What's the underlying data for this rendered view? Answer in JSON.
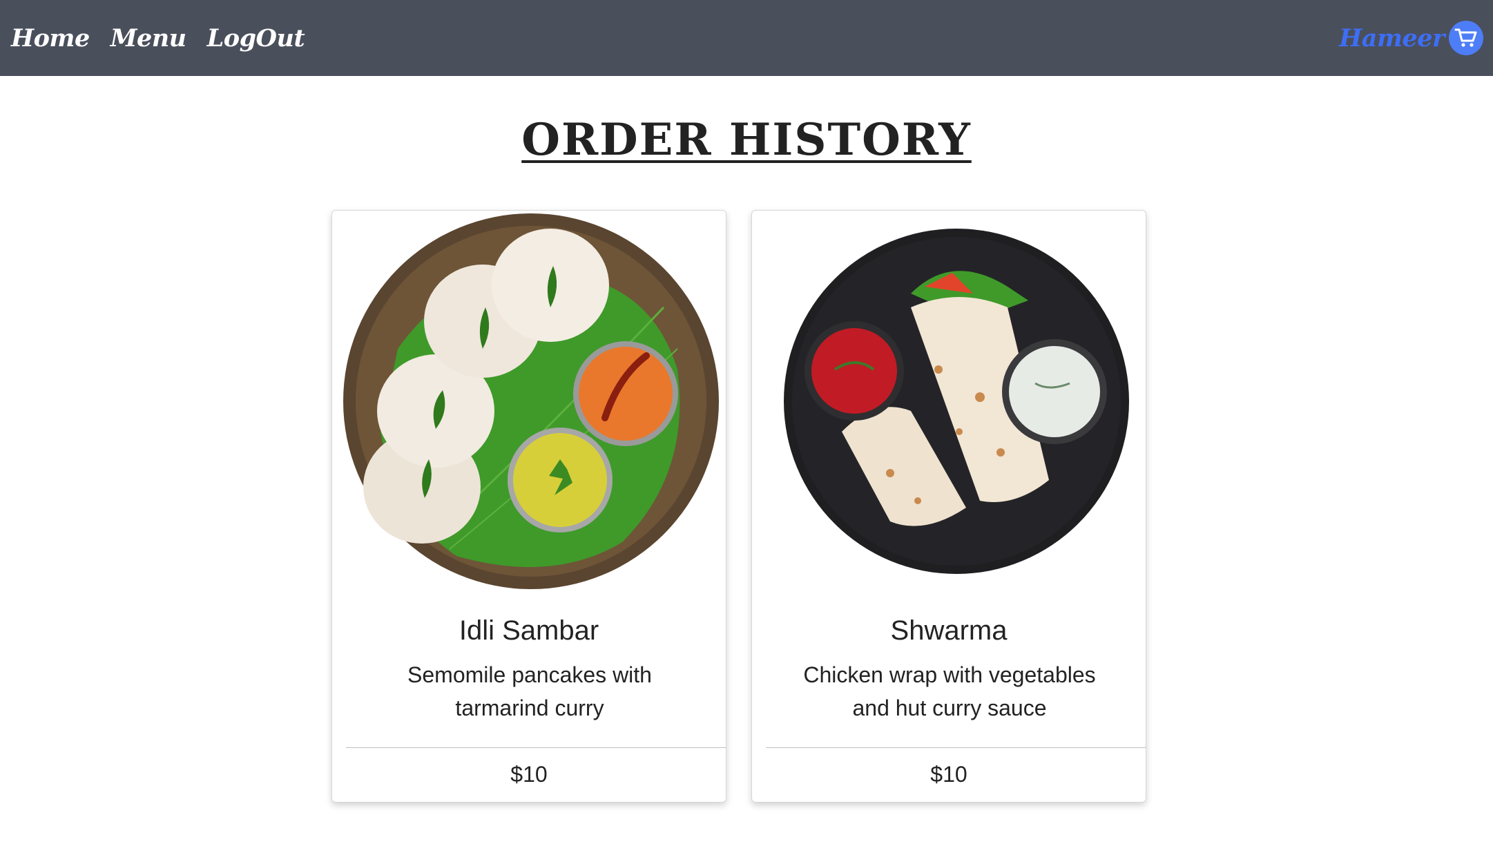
{
  "nav": {
    "home": "Home",
    "menu": "Menu",
    "logout": "LogOut",
    "username": "Hameer",
    "cart_icon": "shopping-cart-icon"
  },
  "page": {
    "title": "ORDER HISTORY"
  },
  "orders": [
    {
      "name": "Idli Sambar",
      "description": "Semomile pancakes with tarmarind curry",
      "price": "$10",
      "image": "idli-sambar-plate"
    },
    {
      "name": "Shwarma",
      "description": "Chicken wrap with vegetables and hut curry sauce",
      "price": "$10",
      "image": "shwarma-plate"
    }
  ],
  "colors": {
    "navbar": "#4a4f5c",
    "nav_text": "#ffffff",
    "username": "#3d6ef5",
    "cart_bg": "#4d7ef7"
  }
}
